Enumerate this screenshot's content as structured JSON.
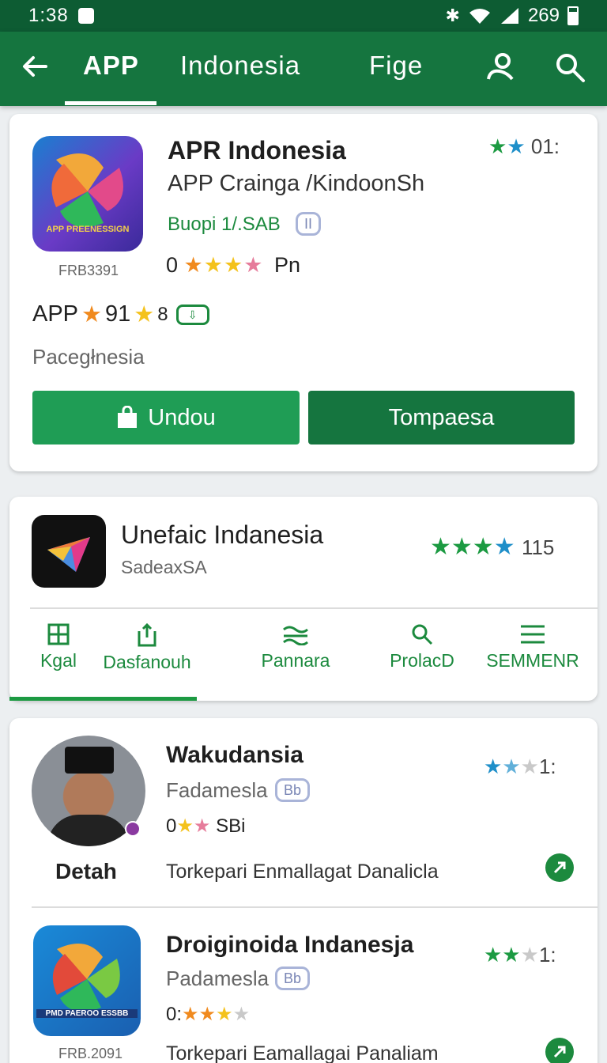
{
  "status": {
    "time": "1:38",
    "battery": "269"
  },
  "appbar": {
    "tabs": [
      "APP",
      "Indonesia",
      "Fige"
    ],
    "active_tab": 0
  },
  "card1": {
    "title": "APR Indonesia",
    "subtitle": "APP Crainga /KindoonSh",
    "developer": "Buopi 1/.SAB",
    "badge": "II",
    "rating_prefix": "0",
    "rating_suffix": "Pn",
    "corner_rating": "01:",
    "icon_caption": "APP PREENESSIGN",
    "size_label": "FRB3391",
    "meta_app": "APP",
    "meta_num1": "91",
    "meta_num2": "8",
    "category": "Pacegłnesia",
    "btn_download": "Undou",
    "btn_other": "Tompaesa"
  },
  "card2": {
    "title": "Unefaic Indanesia",
    "subtitle": "SadeaxSA",
    "rating": "115",
    "nav": [
      "Kgal",
      "Dasfanouh",
      "Pannara",
      "ProlacD",
      "SEMMENR"
    ]
  },
  "card3": {
    "item1": {
      "name": "Detah",
      "title": "Wakudansia",
      "subtitle": "Fadamesla",
      "badge": "Bb",
      "rating_prefix": "0",
      "rating_suffix": "SBi",
      "corner": "1:",
      "desc": "Torkepari Enmallagat Danalicla"
    },
    "item2": {
      "title": "Droiginoida Indanesja",
      "subtitle": "Padamesla",
      "badge": "Bb",
      "rating_prefix": "0:",
      "corner": "1:",
      "icon_caption": "PMD PAEROO ESSBB",
      "size_label": "FRB.2091",
      "desc": "Torkepari Eamallagai Panaliam"
    }
  }
}
